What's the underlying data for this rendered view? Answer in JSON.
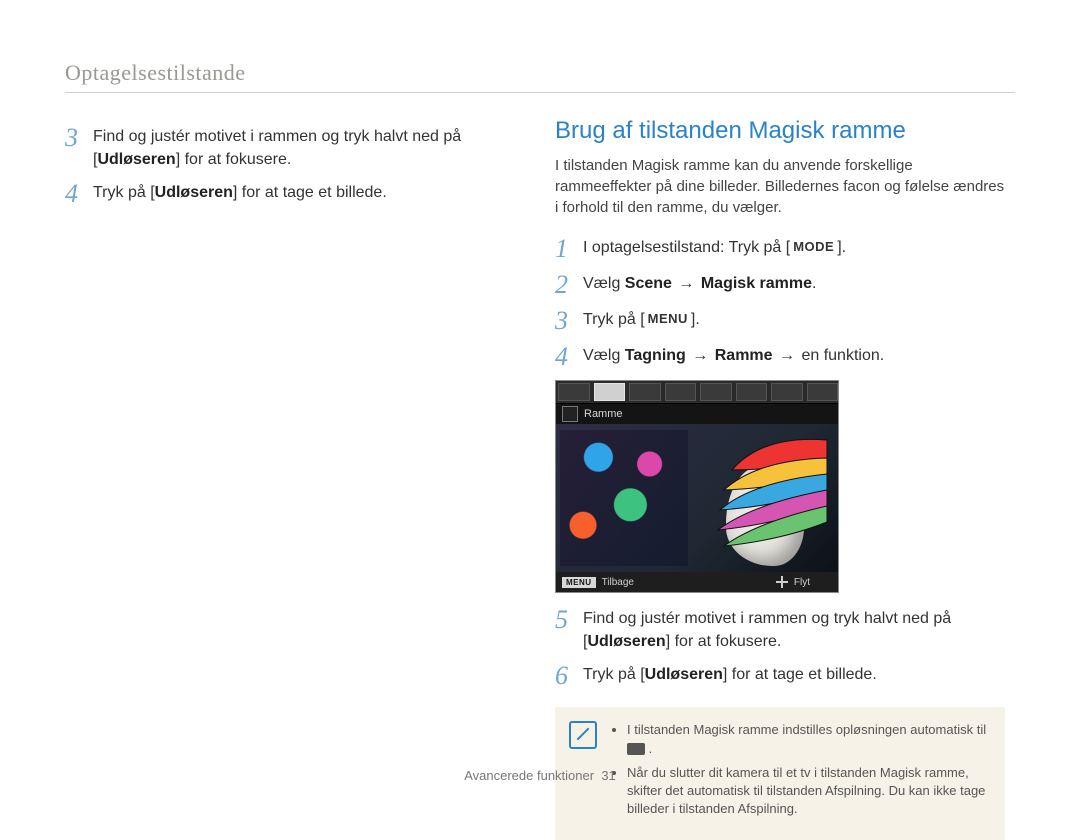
{
  "section_title": "Optagelsestilstande",
  "left_steps": [
    {
      "n": "3",
      "pre": "Find og justér motivet i rammen og tryk halvt ned på [",
      "bold": "Udløseren",
      "post": "] for at fokusere."
    },
    {
      "n": "4",
      "pre": "Tryk på [",
      "bold": "Udløseren",
      "post": "] for at tage et billede."
    }
  ],
  "right": {
    "heading": "Brug af tilstanden Magisk ramme",
    "intro": "I tilstanden Magisk ramme kan du anvende forskellige rammeeffekter på dine billeder. Billedernes facon og følelse ændres i forhold til den ramme, du vælger.",
    "steps_a": {
      "s1": {
        "n": "1",
        "pre": "I optagelsestilstand: Tryk på [",
        "kbd": "MODE",
        "post": "]."
      },
      "s2": {
        "n": "2",
        "pre": "Vælg ",
        "bold1": "Scene",
        "arrow": "→",
        "bold2": "Magisk ramme",
        "post": "."
      },
      "s3": {
        "n": "3",
        "pre": "Tryk på [",
        "kbd": "MENU",
        "post": "]."
      },
      "s4": {
        "n": "4",
        "pre": "Vælg ",
        "bold1": "Tagning",
        "arrow1": "→",
        "bold2": "Ramme",
        "arrow2": "→",
        "tail": "en funktion."
      }
    },
    "preview": {
      "label": "Ramme",
      "menu_chip": "MENU",
      "menu_back": "Tilbage",
      "move": "Flyt"
    },
    "steps_b": [
      {
        "n": "5",
        "pre": "Find og justér motivet i rammen og tryk halvt ned på [",
        "bold": "Udløseren",
        "post": "] for at fokusere."
      },
      {
        "n": "6",
        "pre": "Tryk på [",
        "bold": "Udløseren",
        "post": "] for at tage et billede."
      }
    ],
    "notes": [
      "I tilstanden Magisk ramme indstilles opløsningen automatisk til ",
      "Når du slutter dit kamera til et tv i tilstanden Magisk ramme, skifter det automatisk til tilstanden Afspilning. Du kan ikke tage billeder i tilstanden Afspilning."
    ]
  },
  "footer": {
    "label": "Avancerede funktioner",
    "page": "31"
  }
}
